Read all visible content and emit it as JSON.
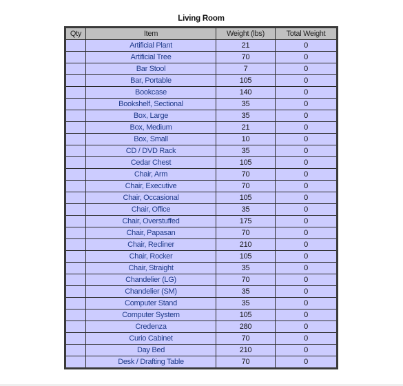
{
  "title": "Living Room",
  "columns": [
    "Qty",
    "Item",
    "Weight (lbs)",
    "Total Weight"
  ],
  "rows": [
    {
      "qty": "",
      "item": "Artificial Plant",
      "weight": "21",
      "total": "0"
    },
    {
      "qty": "",
      "item": "Artificial Tree",
      "weight": "70",
      "total": "0"
    },
    {
      "qty": "",
      "item": "Bar Stool",
      "weight": "7",
      "total": "0"
    },
    {
      "qty": "",
      "item": "Bar, Portable",
      "weight": "105",
      "total": "0"
    },
    {
      "qty": "",
      "item": "Bookcase",
      "weight": "140",
      "total": "0"
    },
    {
      "qty": "",
      "item": "Bookshelf, Sectional",
      "weight": "35",
      "total": "0"
    },
    {
      "qty": "",
      "item": "Box, Large",
      "weight": "35",
      "total": "0"
    },
    {
      "qty": "",
      "item": "Box, Medium",
      "weight": "21",
      "total": "0"
    },
    {
      "qty": "",
      "item": "Box, Small",
      "weight": "10",
      "total": "0"
    },
    {
      "qty": "",
      "item": "CD / DVD Rack",
      "weight": "35",
      "total": "0"
    },
    {
      "qty": "",
      "item": "Cedar Chest",
      "weight": "105",
      "total": "0"
    },
    {
      "qty": "",
      "item": "Chair, Arm",
      "weight": "70",
      "total": "0"
    },
    {
      "qty": "",
      "item": "Chair, Executive",
      "weight": "70",
      "total": "0"
    },
    {
      "qty": "",
      "item": "Chair, Occasional",
      "weight": "105",
      "total": "0"
    },
    {
      "qty": "",
      "item": "Chair, Office",
      "weight": "35",
      "total": "0"
    },
    {
      "qty": "",
      "item": "Chair, Overstuffed",
      "weight": "175",
      "total": "0"
    },
    {
      "qty": "",
      "item": "Chair, Papasan",
      "weight": "70",
      "total": "0"
    },
    {
      "qty": "",
      "item": "Chair, Recliner",
      "weight": "210",
      "total": "0"
    },
    {
      "qty": "",
      "item": "Chair, Rocker",
      "weight": "105",
      "total": "0"
    },
    {
      "qty": "",
      "item": "Chair, Straight",
      "weight": "35",
      "total": "0"
    },
    {
      "qty": "",
      "item": "Chandelier (LG)",
      "weight": "70",
      "total": "0"
    },
    {
      "qty": "",
      "item": "Chandelier (SM)",
      "weight": "35",
      "total": "0"
    },
    {
      "qty": "",
      "item": "Computer Stand",
      "weight": "35",
      "total": "0"
    },
    {
      "qty": "",
      "item": "Computer System",
      "weight": "105",
      "total": "0"
    },
    {
      "qty": "",
      "item": "Credenza",
      "weight": "280",
      "total": "0"
    },
    {
      "qty": "",
      "item": "Curio Cabinet",
      "weight": "70",
      "total": "0"
    },
    {
      "qty": "",
      "item": "Day Bed",
      "weight": "210",
      "total": "0"
    },
    {
      "qty": "",
      "item": "Desk / Drafting Table",
      "weight": "70",
      "total": "0"
    }
  ],
  "colors": {
    "header_bg": "#c0c0c0",
    "row_bg": "#ccccff",
    "item_text": "#1f3b8a",
    "border": "#3a3a3a"
  }
}
